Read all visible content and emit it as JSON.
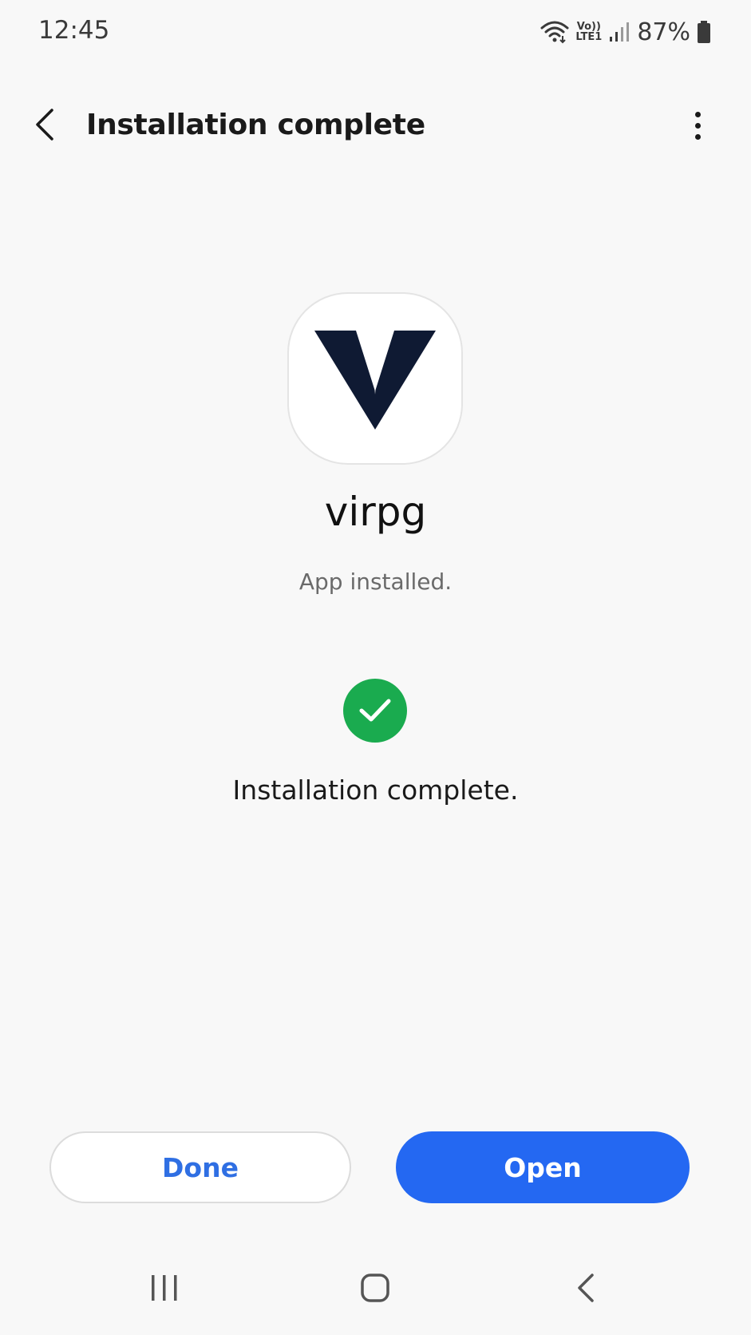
{
  "status_bar": {
    "time": "12:45",
    "network_line1": "Vo))",
    "network_line2": "LTE1",
    "battery_percent": "87%",
    "icons": [
      "wifi-icon",
      "volte-icon",
      "signal-icon",
      "battery-icon"
    ]
  },
  "header": {
    "title": "Installation complete",
    "back_icon": "back-arrow-icon",
    "more_icon": "more-options-icon"
  },
  "app": {
    "name": "virpg",
    "status": "App installed.",
    "icon": "app-logo-icon",
    "logo_color": "#0f1a33"
  },
  "result": {
    "message": "Installation complete.",
    "icon": "check-circle-icon",
    "color": "#1aab4f"
  },
  "actions": {
    "done_label": "Done",
    "open_label": "Open",
    "accent_color": "#2468f2"
  },
  "nav_bar": {
    "recents_icon": "recents-icon",
    "home_icon": "home-icon",
    "back_icon": "nav-back-icon"
  }
}
